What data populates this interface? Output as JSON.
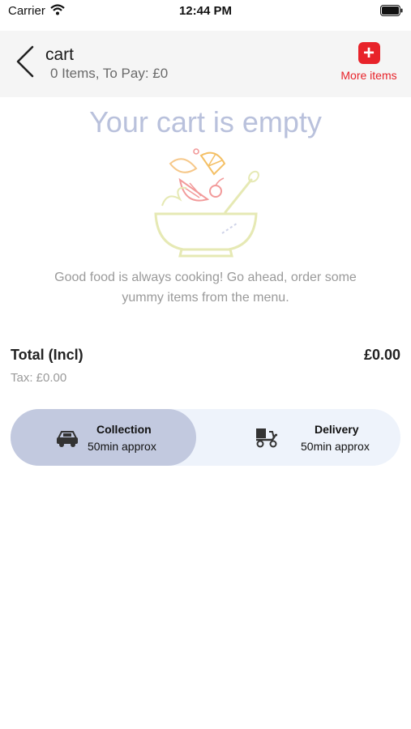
{
  "status_bar": {
    "carrier": "Carrier",
    "time": "12:44 PM"
  },
  "header": {
    "title": "cart",
    "subtitle": "0 Items, To Pay: £0",
    "more_items_label": "More items",
    "plus_glyph": "+"
  },
  "empty_state": {
    "title": "Your cart is empty",
    "message": "Good food is always cooking! Go ahead, order some yummy items from the menu."
  },
  "totals": {
    "total_label": "Total (Incl)",
    "total_value": "£0.00",
    "tax_label": "Tax: £0.00"
  },
  "order_type": {
    "selected": "Collection",
    "options": [
      {
        "name": "Collection",
        "time": "50min approx",
        "icon": "car-icon"
      },
      {
        "name": "Delivery",
        "time": "50min approx",
        "icon": "delivery-scooter-icon"
      }
    ]
  },
  "colors": {
    "accent_red": "#e8232a",
    "selected_option": "#c2c9df",
    "toggle_background": "#eef3fb",
    "empty_title": "#b9c1dc"
  }
}
